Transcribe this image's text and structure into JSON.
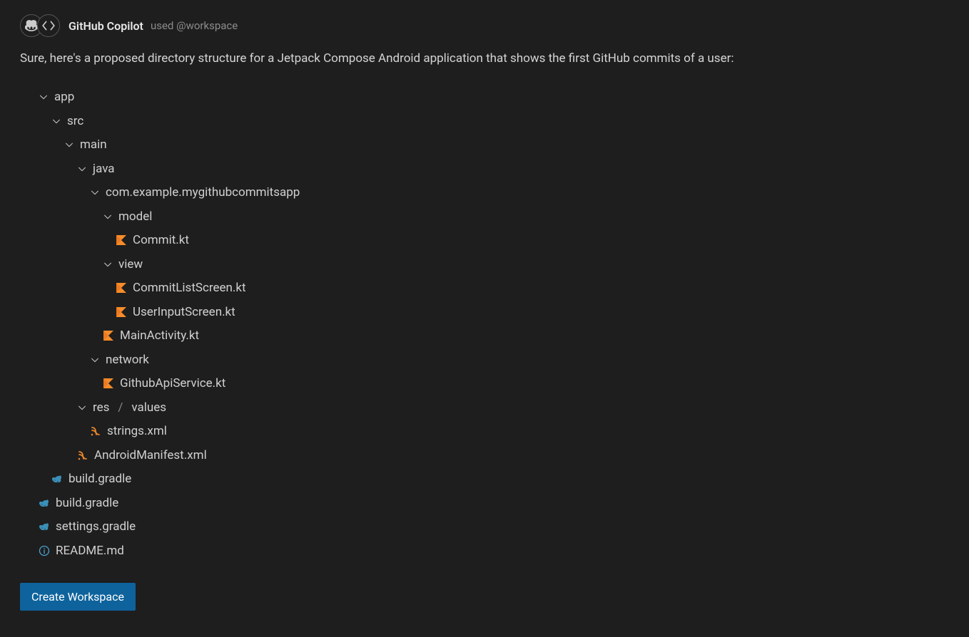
{
  "header": {
    "title": "GitHub Copilot",
    "used_label": "used",
    "workspace_label": "@workspace"
  },
  "intro": "Sure, here's a proposed directory structure for a Jetpack Compose Android application that shows the first GitHub commits of a user:",
  "tree": [
    {
      "indent": 1,
      "type": "folder",
      "label": "app"
    },
    {
      "indent": 2,
      "type": "folder",
      "label": "src"
    },
    {
      "indent": 3,
      "type": "folder",
      "label": "main"
    },
    {
      "indent": 4,
      "type": "folder",
      "label": "java"
    },
    {
      "indent": 5,
      "type": "folder",
      "label": "com.example.mygithubcommitsapp"
    },
    {
      "indent": 6,
      "type": "folder",
      "label": "model"
    },
    {
      "indent": 7,
      "type": "kotlin",
      "label": "Commit.kt"
    },
    {
      "indent": 6,
      "type": "folder",
      "label": "view"
    },
    {
      "indent": 7,
      "type": "kotlin",
      "label": "CommitListScreen.kt"
    },
    {
      "indent": 7,
      "type": "kotlin",
      "label": "UserInputScreen.kt"
    },
    {
      "indent": 6,
      "type": "kotlin",
      "label": "MainActivity.kt"
    },
    {
      "indent": 5,
      "type": "folder",
      "label": "network"
    },
    {
      "indent": 6,
      "type": "kotlin",
      "label": "GithubApiService.kt"
    },
    {
      "indent": 4,
      "type": "folder-path",
      "label": "res",
      "label2": "values"
    },
    {
      "indent": 5,
      "type": "xml",
      "label": "strings.xml"
    },
    {
      "indent": 4,
      "type": "xml",
      "label": "AndroidManifest.xml"
    },
    {
      "indent": 2,
      "type": "gradle",
      "label": "build.gradle"
    },
    {
      "indent": 1,
      "type": "gradle",
      "label": "build.gradle"
    },
    {
      "indent": 1,
      "type": "gradle",
      "label": "settings.gradle"
    },
    {
      "indent": 1,
      "type": "info",
      "label": "README.md"
    }
  ],
  "button": {
    "create_workspace": "Create Workspace"
  },
  "icons": {
    "copilot": "copilot-icon",
    "code": "code-icon",
    "chevron_down": "chevron-down-icon",
    "kotlin": "kotlin-file-icon",
    "xml": "xml-file-icon",
    "gradle": "gradle-file-icon",
    "info": "info-file-icon"
  }
}
